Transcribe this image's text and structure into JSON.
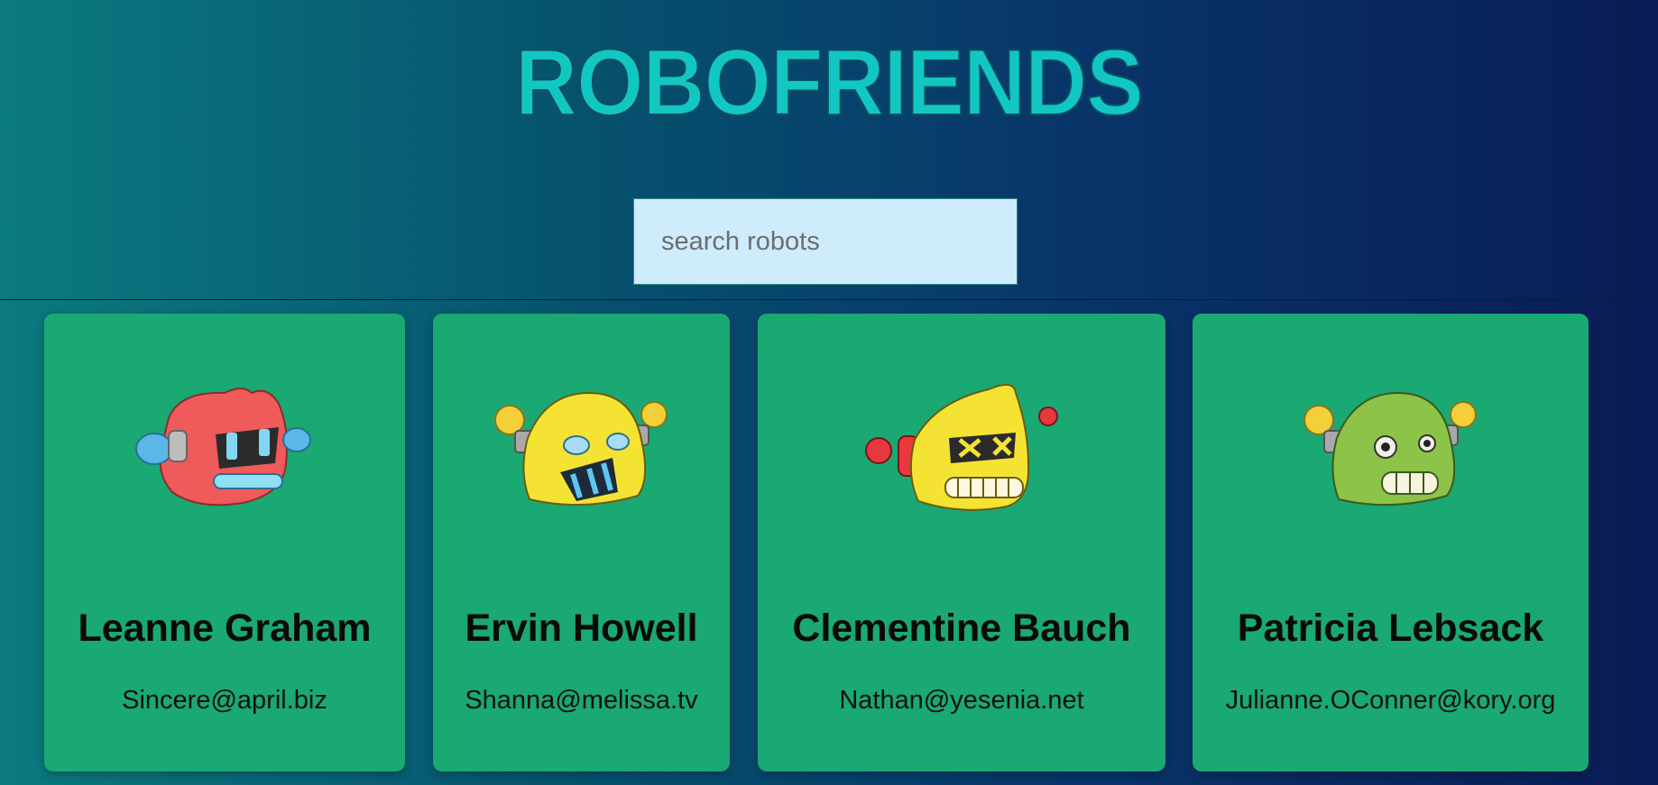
{
  "app": {
    "title": "ROBOFRIENDS"
  },
  "search": {
    "placeholder": "search robots",
    "value": ""
  },
  "robots": [
    {
      "name": "Leanne Graham",
      "email": "Sincere@april.biz",
      "avatar_color": "#ef5a5a",
      "avatar": "robot-red-icon"
    },
    {
      "name": "Ervin Howell",
      "email": "Shanna@melissa.tv",
      "avatar_color": "#f5e334",
      "avatar": "robot-yellow-icon"
    },
    {
      "name": "Clementine Bauch",
      "email": "Nathan@yesenia.net",
      "avatar_color": "#f5e334",
      "avatar": "robot-yellow-icon"
    },
    {
      "name": "Patricia Lebsack",
      "email": "Julianne.OConner@kory.org",
      "avatar_color": "#8dc348",
      "avatar": "robot-green-icon"
    }
  ],
  "colors": {
    "title": "#12c6c3",
    "card_background": "#1aa873",
    "search_background": "#cfecfc"
  }
}
